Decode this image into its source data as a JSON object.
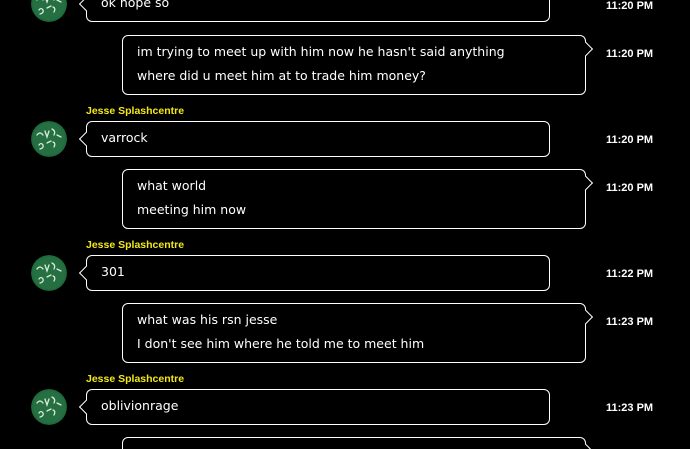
{
  "colors": {
    "background": "#000000",
    "bubble_border": "#ffffff",
    "sender_name": "#f2e81a",
    "avatar_green": "#1e6b3c"
  },
  "messages": [
    {
      "direction": "incoming",
      "lines": [
        "ok hope so"
      ],
      "time": "11:20 PM"
    },
    {
      "direction": "outgoing",
      "lines": [
        "im trying to meet up with him now he hasn't said anything",
        "where did u meet him at to trade him money?"
      ],
      "time": "11:20 PM"
    },
    {
      "direction": "incoming",
      "sender": "Jesse Splashcentre",
      "lines": [
        "varrock"
      ],
      "time": "11:20 PM"
    },
    {
      "direction": "outgoing",
      "lines": [
        "what world",
        "meeting him now"
      ],
      "time": "11:20 PM"
    },
    {
      "direction": "incoming",
      "sender": "Jesse Splashcentre",
      "lines": [
        "301"
      ],
      "time": "11:22 PM"
    },
    {
      "direction": "outgoing",
      "lines": [
        "what was his rsn jesse",
        "I don't see him where he told me to meet him"
      ],
      "time": "11:23 PM"
    },
    {
      "direction": "incoming",
      "sender": "Jesse Splashcentre",
      "lines": [
        "oblivionrage"
      ],
      "time": "11:23 PM"
    }
  ],
  "avatar_icon": "green-chalkboard-avatar-icon"
}
